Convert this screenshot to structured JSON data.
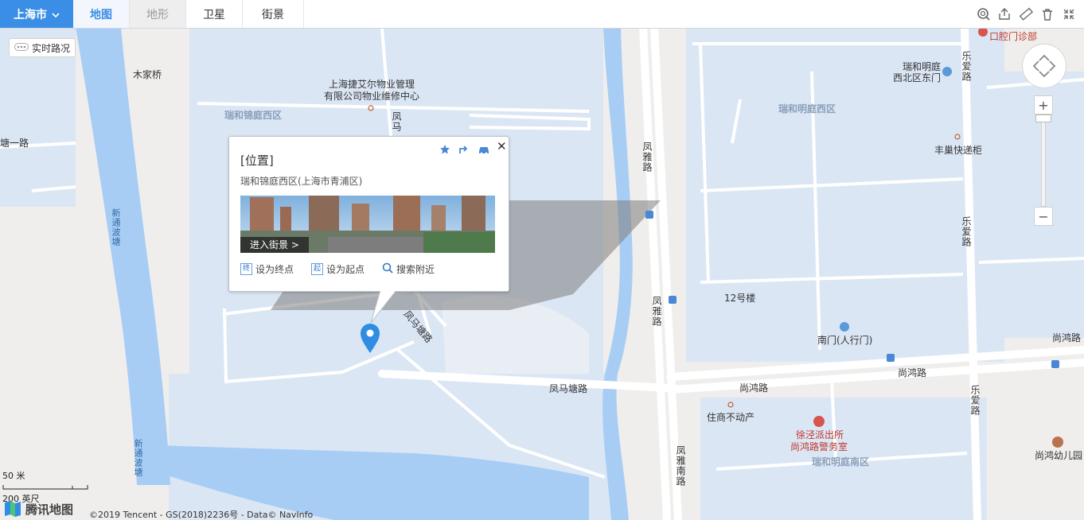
{
  "toolbar": {
    "city": "上海市",
    "tabs": [
      {
        "label": "地图",
        "state": "active"
      },
      {
        "label": "地形",
        "state": "disabled"
      },
      {
        "label": "卫星",
        "state": "normal"
      },
      {
        "label": "街景",
        "state": "normal"
      }
    ],
    "tools": [
      "search-icon",
      "share-icon",
      "ruler-icon",
      "trash-icon",
      "fullscreen-icon"
    ]
  },
  "traffic": {
    "label": "实时路况"
  },
  "labels": {
    "mujiaqiao": "木家桥",
    "property_line1": "上海捷艾尔物业管理",
    "property_line2": "有限公司物业维修中心",
    "ruihe_jinting_west": "瑞和锦庭西区",
    "ruihe_mingting_west": "瑞和明庭西区",
    "ruihe_mingting_south": "瑞和明庭南区",
    "ruihe_northwest_gate_1": "瑞和明庭",
    "ruihe_northwest_gate_2": "西北区东门",
    "dental": "口腔门诊部",
    "fengchao": "丰巢快递柜",
    "building12": "12号楼",
    "south_gate": "南门(人行门)",
    "zhushang": "住商不动产",
    "police_1": "徐泾派出所",
    "police_2": "尚鸿路警务室",
    "kindergarten": "尚鸿幼儿园",
    "xintongbotang_1": "新通波塘",
    "xintongbotang_2": "新通波塘",
    "fengmatang_road_a": "凤马塘",
    "fengmatang_road_b": "凤马塘路",
    "fengmatang_road_c": "凤马塘路",
    "fengya_road_a": "凤雅路",
    "fengya_road_b": "凤雅路",
    "fengya_south": "凤雅南路",
    "leai_road_a": "乐爱路",
    "leai_road_b": "乐爱路",
    "leai_road_c": "乐爱路",
    "shanghong_a": "尚鸿路",
    "shanghong_b": "尚鸿路",
    "shanghong_c": "尚鸿路",
    "tang1_road": "塘一路",
    "fengma_vertical": "凤马"
  },
  "popup": {
    "title": "[位置]",
    "address": "瑞和锦庭西区(上海市青浦区)",
    "streetview_btn": "进入街景 >",
    "actions": [
      {
        "badge": "终",
        "label": "设为终点"
      },
      {
        "badge": "起",
        "label": "设为起点"
      },
      {
        "badge": "",
        "label": "搜索附近"
      }
    ]
  },
  "scale": {
    "metric": "50 米",
    "imperial": "200 英尺"
  },
  "footer": {
    "logo": "腾讯地图",
    "copyright": "©2019 Tencent - GS(2018)2236号 - Data© NavInfo"
  },
  "colors": {
    "water": "#a8cdf5",
    "block": "#dbe6f5",
    "road": "#ffffff",
    "ground": "#efeeec",
    "accent": "#3a8ee6",
    "marker": "#2f8de4"
  }
}
